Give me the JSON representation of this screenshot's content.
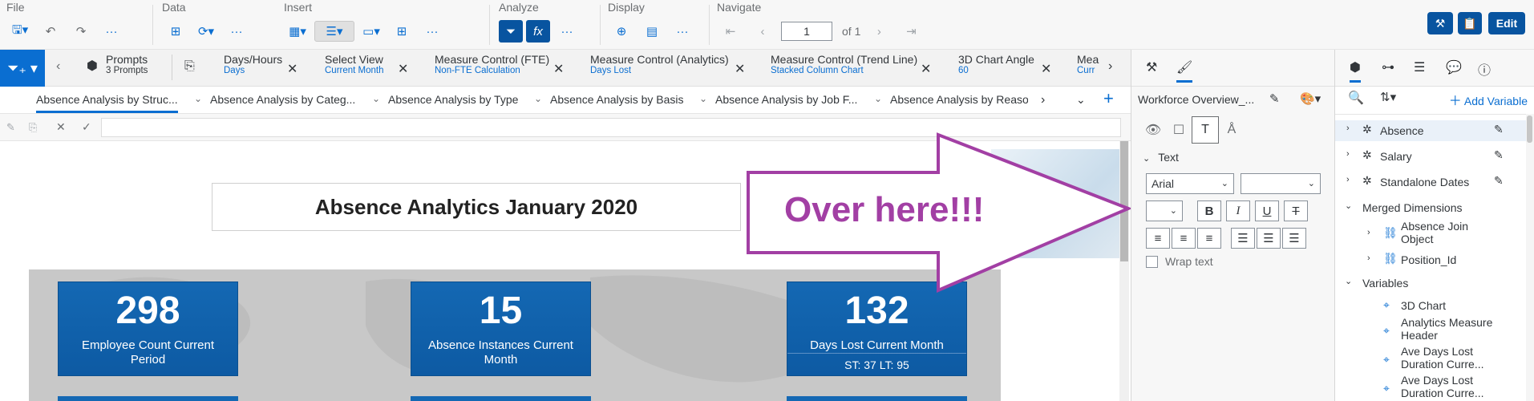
{
  "toolbar": {
    "groups": {
      "file": "File",
      "data": "Data",
      "insert": "Insert",
      "analyze": "Analyze",
      "display": "Display",
      "navigate": "Navigate"
    },
    "page_current": "1",
    "page_total": "of 1",
    "edit_label": "Edit",
    "more": "···"
  },
  "prompts_bar": {
    "items": [
      {
        "title": "Prompts",
        "sub": "3 Prompts"
      },
      {
        "title": "Days/Hours",
        "sub": "Days"
      },
      {
        "title": "Select View",
        "sub": "Current Month"
      },
      {
        "title": "Measure Control (FTE)",
        "sub": "Non-FTE Calculation"
      },
      {
        "title": "Measure Control (Analytics)",
        "sub": "Days Lost"
      },
      {
        "title": "Measure Control (Trend Line)",
        "sub": "Stacked Column Chart"
      },
      {
        "title": "3D Chart Angle",
        "sub": "60"
      },
      {
        "title": "Mea",
        "sub": "Curr"
      }
    ]
  },
  "tabs": [
    "Absence Analysis by Struc...",
    "Absence Analysis by Categ...",
    "Absence Analysis by Type",
    "Absence Analysis by Basis",
    "Absence Analysis by Job F...",
    "Absence Analysis by Reaso"
  ],
  "report": {
    "title": "Absence Analytics January 2020",
    "kpis": [
      {
        "value": "298",
        "label": "Employee Count Current Period",
        "sub": ""
      },
      {
        "value": "15",
        "label": "Absence Instances Current Month",
        "sub": ""
      },
      {
        "value": "132",
        "label": "Days Lost Current Month",
        "sub": "ST: 37 LT: 95"
      }
    ]
  },
  "properties": {
    "doc_name": "Workforce Overview_...",
    "section_text": "Text",
    "font_family": "Arial",
    "font_size": "",
    "bold": "B",
    "italic": "I",
    "underline": "U",
    "strike": "T",
    "wrap_text": "Wrap text"
  },
  "outline": {
    "add_variable": "Add Variable",
    "objects": [
      "Absence",
      "Salary",
      "Standalone Dates"
    ],
    "merged_header": "Merged Dimensions",
    "merged": [
      "Absence Join Object",
      "Position_Id"
    ],
    "variables_header": "Variables",
    "variables": [
      "3D Chart",
      "Analytics Measure Header",
      "Ave Days Lost Duration Curre...",
      "Ave Days Lost Duration Curre..."
    ]
  },
  "annotation": {
    "text": "Over here!!!",
    "color": "#a23fa4"
  },
  "colors": {
    "accent": "#0a6ed1",
    "kpi_blue": "#1468b3",
    "dark_button": "#0854a0"
  }
}
